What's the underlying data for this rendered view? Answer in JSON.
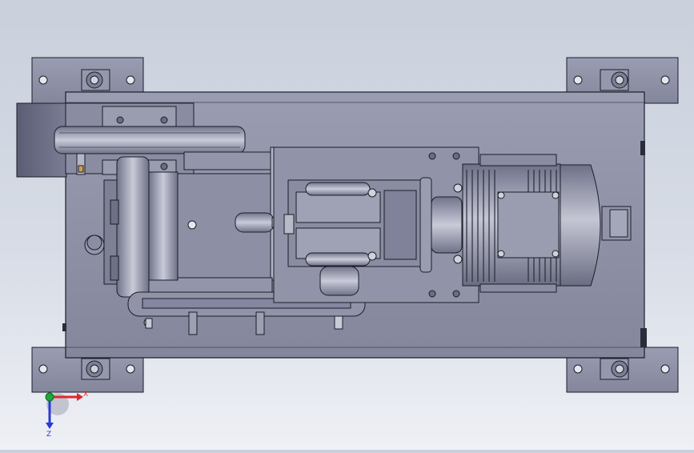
{
  "viewport": {
    "background_top": "#c9d0dc",
    "background_bottom": "#eef0f5",
    "part_fill": "#8f92a8",
    "part_edge": "#1c1c28"
  },
  "triad": {
    "x_label": "X",
    "z_label": "Z",
    "x_color": "#e0282c",
    "y_color": "#1aa83a",
    "z_color": "#2a3ad6"
  }
}
